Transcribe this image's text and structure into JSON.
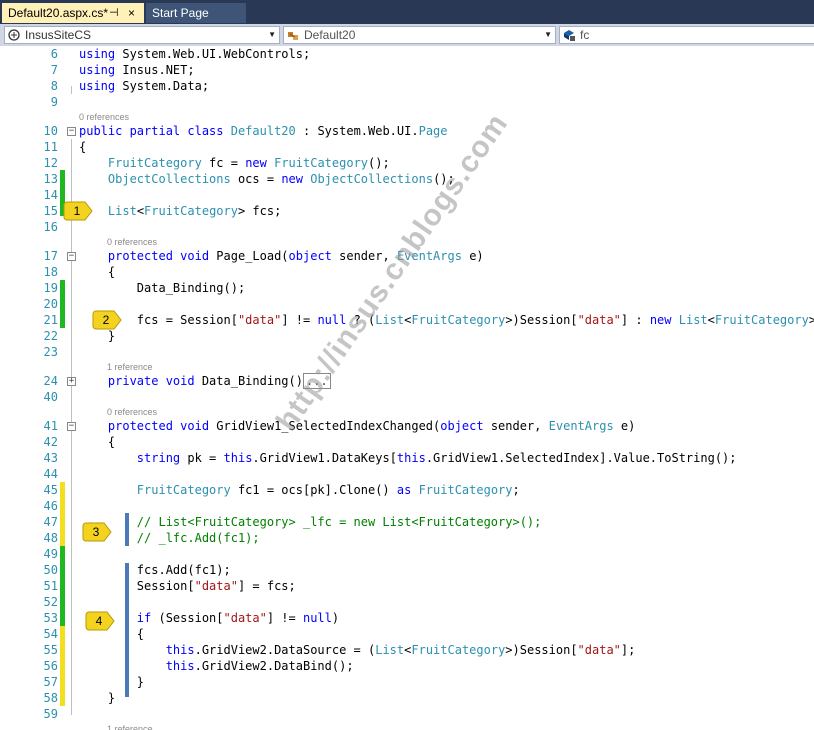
{
  "tabs": {
    "active": "Default20.aspx.cs*",
    "pin_glyph": "⊣",
    "close_glyph": "×",
    "other": "Start Page"
  },
  "navbar": {
    "project": "InsusSiteCS",
    "class": "Default20",
    "member": "fc"
  },
  "icons": [
    "csharp-project-icon",
    "class-icon",
    "field-icon",
    "dropdown-arrow-icon",
    "fold-toggle-icon"
  ],
  "colors": {
    "keyword": "#0000ff",
    "type": "#2b91af",
    "string": "#a31515",
    "comment": "#008000",
    "saved_change": "#20b820",
    "unsaved_change": "#f2e020"
  },
  "code_lines": [
    {
      "n": "6",
      "text": "using System.Web.UI.WebControls;"
    },
    {
      "n": "7",
      "text": "using Insus.NET;"
    },
    {
      "n": "8",
      "text": "using System.Data;"
    },
    {
      "n": "9",
      "text": ""
    },
    {
      "lens": "0 references"
    },
    {
      "n": "10",
      "text": "public partial class Default20 : System.Web.UI.Page"
    },
    {
      "n": "11",
      "text": "{"
    },
    {
      "n": "12",
      "text": "FruitCategory fc = new FruitCategory();"
    },
    {
      "n": "13",
      "text": "ObjectCollections ocs = new ObjectCollections();"
    },
    {
      "n": "14",
      "text": ""
    },
    {
      "n": "15",
      "text": "List<FruitCategory> fcs;"
    },
    {
      "n": "16",
      "text": ""
    },
    {
      "lens": "0 references"
    },
    {
      "n": "17",
      "text": "protected void Page_Load(object sender, EventArgs e)"
    },
    {
      "n": "18",
      "text": "{"
    },
    {
      "n": "19",
      "text": "Data_Binding();"
    },
    {
      "n": "20",
      "text": ""
    },
    {
      "n": "21",
      "text": "fcs = Session[\"data\"] != null ? (List<FruitCategory>)Session[\"data\"] : new List<FruitCategory>();"
    },
    {
      "n": "22",
      "text": "}"
    },
    {
      "n": "23",
      "text": ""
    },
    {
      "lens": "1 reference"
    },
    {
      "n": "24",
      "text": "private void Data_Binding()",
      "ellipsis": "..."
    },
    {
      "n": "40",
      "text": ""
    },
    {
      "lens": "0 references"
    },
    {
      "n": "41",
      "text": "protected void GridView1_SelectedIndexChanged(object sender, EventArgs e)"
    },
    {
      "n": "42",
      "text": "{"
    },
    {
      "n": "43",
      "text": "string pk = this.GridView1.DataKeys[this.GridView1.SelectedIndex].Value.ToString();"
    },
    {
      "n": "44",
      "text": ""
    },
    {
      "n": "45",
      "text": "FruitCategory fc1 = ocs[pk].Clone() as FruitCategory;"
    },
    {
      "n": "46",
      "text": ""
    },
    {
      "n": "47",
      "text": "// List<FruitCategory> _lfc = new List<FruitCategory>();"
    },
    {
      "n": "48",
      "text": "// _lfc.Add(fc1);"
    },
    {
      "n": "49",
      "text": ""
    },
    {
      "n": "50",
      "text": "fcs.Add(fc1);"
    },
    {
      "n": "51",
      "text": "Session[\"data\"] = fcs;"
    },
    {
      "n": "52",
      "text": ""
    },
    {
      "n": "53",
      "text": "if (Session[\"data\"] != null)"
    },
    {
      "n": "54",
      "text": "{"
    },
    {
      "n": "55",
      "text": "this.GridView2.DataSource = (List<FruitCategory>)Session[\"data\"];"
    },
    {
      "n": "56",
      "text": "this.GridView2.DataBind();"
    },
    {
      "n": "57",
      "text": "}"
    },
    {
      "n": "58",
      "text": "}"
    },
    {
      "n": "59",
      "text": ""
    },
    {
      "lens": "1 reference"
    }
  ],
  "callouts": [
    "1",
    "2",
    "3",
    "4"
  ],
  "watermark": "http://insus.cnblogs.com"
}
